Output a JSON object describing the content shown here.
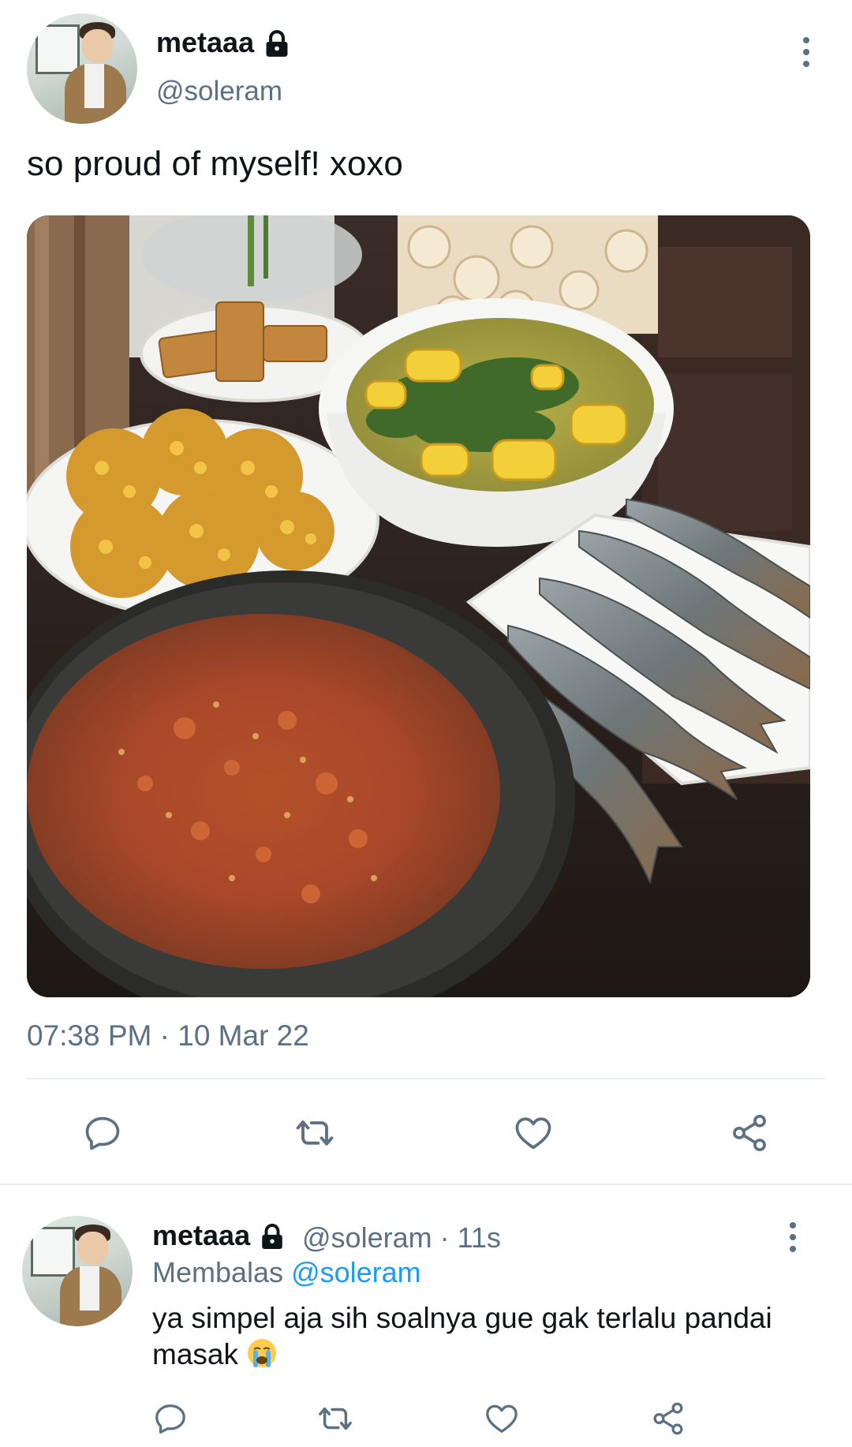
{
  "tweet": {
    "author_name": "metaaa",
    "handle": "@soleram",
    "text": "so proud of myself! xoxo",
    "timestamp": "07:38 PM · 10 Mar 22",
    "icons": [
      "lock-icon",
      "more-icon",
      "reply-icon",
      "retweet-icon",
      "like-icon",
      "share-icon"
    ]
  },
  "reply": {
    "author_name": "metaaa",
    "meta": "@soleram · 11s",
    "replying_prefix": "Membalas",
    "replying_to": "@soleram",
    "text": "ya simpel aja sih soalnya gue gak terlalu pandai masak",
    "emoji": "loudly-crying-face"
  },
  "colors": {
    "text": "#0f1419",
    "secondary": "#5b7083",
    "link": "#1d9bf0",
    "divider": "#e6ecf0"
  }
}
